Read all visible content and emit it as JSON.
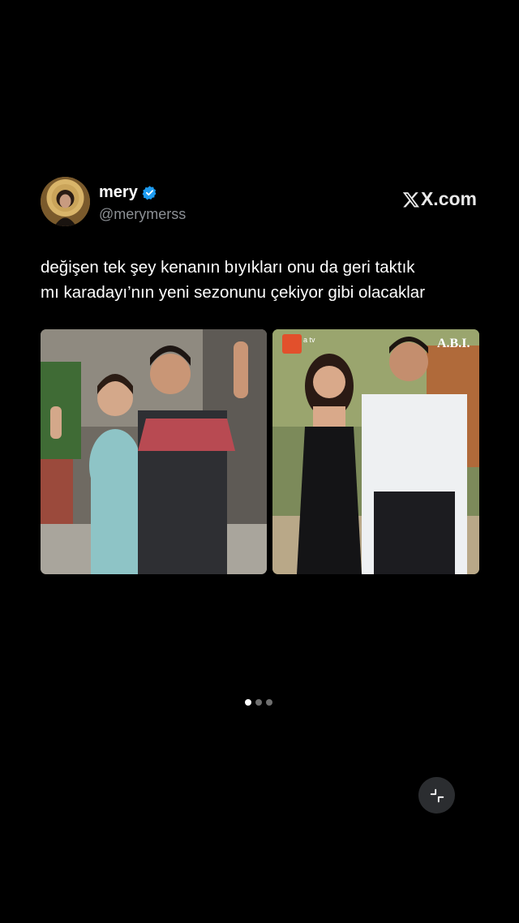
{
  "tweet": {
    "display_name": "mery",
    "handle": "@merymerss",
    "verified": true,
    "text_lines": [
      "değişen tek şey kenanın bıyıkları onu da geri taktık",
      "mı karadayı’nın yeni sezonunu çekiyor gibi olacaklar"
    ],
    "site": "X.com"
  },
  "media": {
    "right_photo_watermark": "A.B.I.",
    "right_photo_channel_logo": "a tv"
  },
  "carousel": {
    "page_count": 3,
    "active_index": 0
  },
  "colors": {
    "background": "#000000",
    "handle": "#8b8f94",
    "verified": "#1d9bf0",
    "button_bg": "#2b2d30"
  },
  "icons": {
    "verified": "verified-badge-icon",
    "x_logo": "x-logo-icon",
    "collapse": "collapse-icon"
  }
}
